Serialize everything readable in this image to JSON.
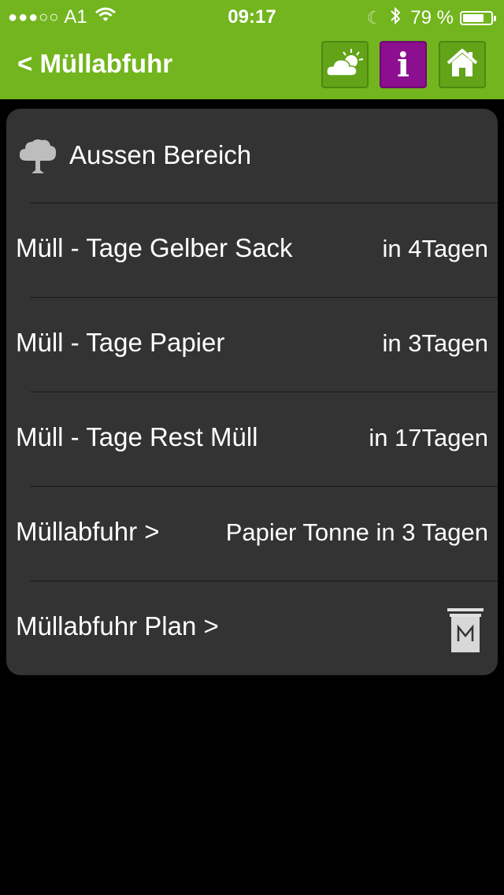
{
  "status_bar": {
    "signal_dots": "●●●○○",
    "carrier": "A1",
    "time": "09:17",
    "battery_percent": "79 %",
    "battery_level": 0.79
  },
  "nav": {
    "back_label": "< Müllabfuhr",
    "info_label": "i",
    "icons": [
      "weather-icon",
      "info-icon",
      "home-icon"
    ],
    "colors": {
      "bar": "#72b51e",
      "info_button": "#8b0f8f"
    }
  },
  "header_row": {
    "label": "Aussen Bereich",
    "icon": "tree-icon"
  },
  "rows": [
    {
      "label": "Müll - Tage Gelber Sack",
      "value": "in 4Tagen"
    },
    {
      "label": "Müll - Tage Papier",
      "value": "in 3Tagen"
    },
    {
      "label": "Müll - Tage Rest Müll",
      "value": "in 17Tagen"
    },
    {
      "label": "Müllabfuhr >",
      "value": "Papier Tonne in 3 Tagen"
    },
    {
      "label": "Müllabfuhr Plan >",
      "icon": "bin-icon"
    }
  ]
}
